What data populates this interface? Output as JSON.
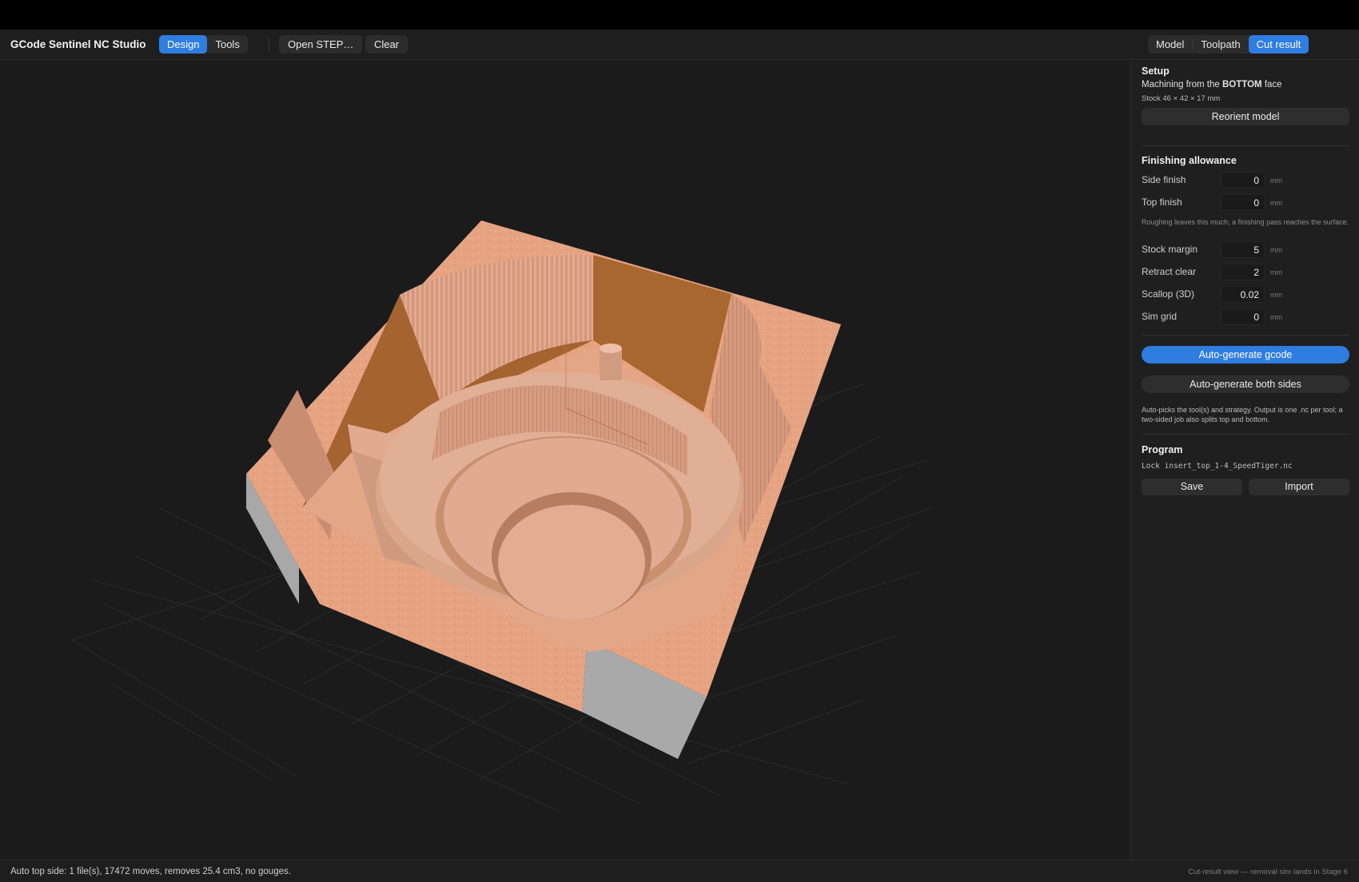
{
  "app": {
    "title": "GCode Sentinel NC Studio"
  },
  "toolbar": {
    "mode_tabs": [
      {
        "label": "Design",
        "active": true
      },
      {
        "label": "Tools",
        "active": false
      }
    ],
    "open_step_label": "Open STEP…",
    "clear_label": "Clear",
    "view_tabs": [
      {
        "label": "Model",
        "active": false
      },
      {
        "label": "Toolpath",
        "active": false
      },
      {
        "label": "Cut result",
        "active": true
      }
    ]
  },
  "panel": {
    "setup": {
      "title": "Setup",
      "machining_prefix": "Machining from the ",
      "machining_face": "BOTTOM",
      "machining_suffix": " face",
      "stock": "Stock 46 × 42 × 17 mm",
      "reorient_label": "Reorient model"
    },
    "finishing": {
      "title": "Finishing allowance",
      "fields": [
        {
          "label": "Side finish",
          "value": "0",
          "unit": "mm"
        },
        {
          "label": "Top finish",
          "value": "0",
          "unit": "mm"
        }
      ],
      "hint": "Roughing leaves this much; a finishing pass reaches the surface.",
      "fields2": [
        {
          "label": "Stock margin",
          "value": "5",
          "unit": "mm"
        },
        {
          "label": "Retract clear",
          "value": "2",
          "unit": "mm"
        },
        {
          "label": "Scallop (3D)",
          "value": "0.02",
          "unit": "mm"
        },
        {
          "label": "Sim grid",
          "value": "0",
          "unit": "mm"
        }
      ]
    },
    "generate": {
      "primary_label": "Auto-generate gcode",
      "both_label": "Auto-generate both sides",
      "hint": "Auto-picks the tool(s) and strategy. Output is one .nc per tool; a two-sided job also splits top and bottom."
    },
    "program": {
      "title": "Program",
      "file": "Lock insert_top_1-4_SpeedTiger.nc",
      "save_label": "Save",
      "import_label": "Import"
    }
  },
  "status": {
    "left": "Auto top side: 1 file(s), 17472 moves, removes 25.4 cm3, no gouges.",
    "right": "Cut-result view — removal sim lands in Stage 6"
  },
  "colors": {
    "accent": "#2f7de0",
    "stock_top": "#e6a382",
    "stock_wall_dark": "#a4632f",
    "stock_side": "#a9a9a9"
  }
}
